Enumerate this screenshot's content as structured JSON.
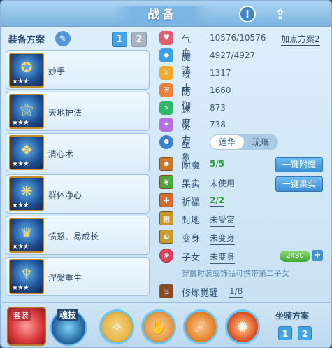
{
  "header": {
    "title": "战备"
  },
  "equip_scheme": {
    "label": "装备方案",
    "tabs": [
      "1",
      "2"
    ],
    "active_tab": "1"
  },
  "skills": [
    {
      "name": "妙手",
      "stars": "★★★"
    },
    {
      "name": "天地护法",
      "stars": "★★★"
    },
    {
      "name": "清心术",
      "stars": "★★★"
    },
    {
      "name": "群体净心",
      "stars": "★★★"
    },
    {
      "name": "愤怒、易成长",
      "stars": "★★★"
    },
    {
      "name": "涅槃重生",
      "stars": "★★★"
    }
  ],
  "attributes": [
    {
      "label": "气血",
      "value": "10576/10576",
      "icon": "heart-icon",
      "color": "#e45b6c",
      "glyph": "♥"
    },
    {
      "label": "魔法",
      "value": "4927/4927",
      "icon": "mana-icon",
      "color": "#3f9ee8",
      "glyph": "◆"
    },
    {
      "label": "攻击",
      "value": "1317",
      "icon": "attack-icon",
      "color": "#f0a92a",
      "glyph": "⚔"
    },
    {
      "label": "防御",
      "value": "1660",
      "icon": "defense-icon",
      "color": "#e8823a",
      "glyph": "⛨"
    },
    {
      "label": "速度",
      "value": "873",
      "icon": "speed-icon",
      "color": "#2fb86a",
      "glyph": "»"
    },
    {
      "label": "灵力",
      "value": "738",
      "icon": "spirit-icon",
      "color": "#b66fe0",
      "glyph": "✦"
    }
  ],
  "add_point_scheme": "加点方案2",
  "star_sign": {
    "label": "星象",
    "options": [
      "莲华",
      "琉璃"
    ],
    "active": "莲华"
  },
  "items": [
    {
      "label": "附魔",
      "value": "5/5",
      "style": "green",
      "button": "一键附魔",
      "icon": "enchant-icon",
      "color": "#c9782a",
      "glyph": "✸"
    },
    {
      "label": "果实",
      "value": "未使用",
      "style": "plain",
      "button": "一键果实",
      "icon": "fruit-icon",
      "color": "#4aa83a",
      "glyph": "❦"
    },
    {
      "label": "祈福",
      "value": "2/2",
      "style": "green",
      "button": "",
      "icon": "bless-icon",
      "color": "#d86a2a",
      "glyph": "✚"
    },
    {
      "label": "封地",
      "value": "未受赏",
      "style": "plain-u",
      "button": "",
      "icon": "fief-icon",
      "color": "#c99a2a",
      "glyph": "▦"
    },
    {
      "label": "变身",
      "value": "未变身",
      "style": "plain-u",
      "button": "",
      "icon": "transform-icon",
      "color": "#c99a2a",
      "glyph": "☯"
    },
    {
      "label": "子女",
      "value": "未变身",
      "style": "plain-u",
      "button": "",
      "icon": "child-icon",
      "color": "#e0405a",
      "glyph": "❀"
    }
  ],
  "child_badge": "2480",
  "hint": "穿戴时装或饰品可携带第二子女",
  "cultivation": {
    "label": "修炼觉醒",
    "value": "1/8"
  },
  "bottom": {
    "suit_label": "套装",
    "soul_label": "魂技",
    "orbs": [
      {
        "name": "orb-1",
        "glyph": "✧",
        "color": "#e7b84a"
      },
      {
        "name": "orb-2",
        "glyph": "✋",
        "color": "#e79c4a"
      },
      {
        "name": "orb-3",
        "glyph": "☄",
        "color": "#e8872f"
      },
      {
        "name": "orb-4",
        "glyph": "✺",
        "color": "#e05a2a"
      }
    ],
    "mount_label": "坐骑方案",
    "mount_tabs": [
      "1",
      "2"
    ]
  }
}
